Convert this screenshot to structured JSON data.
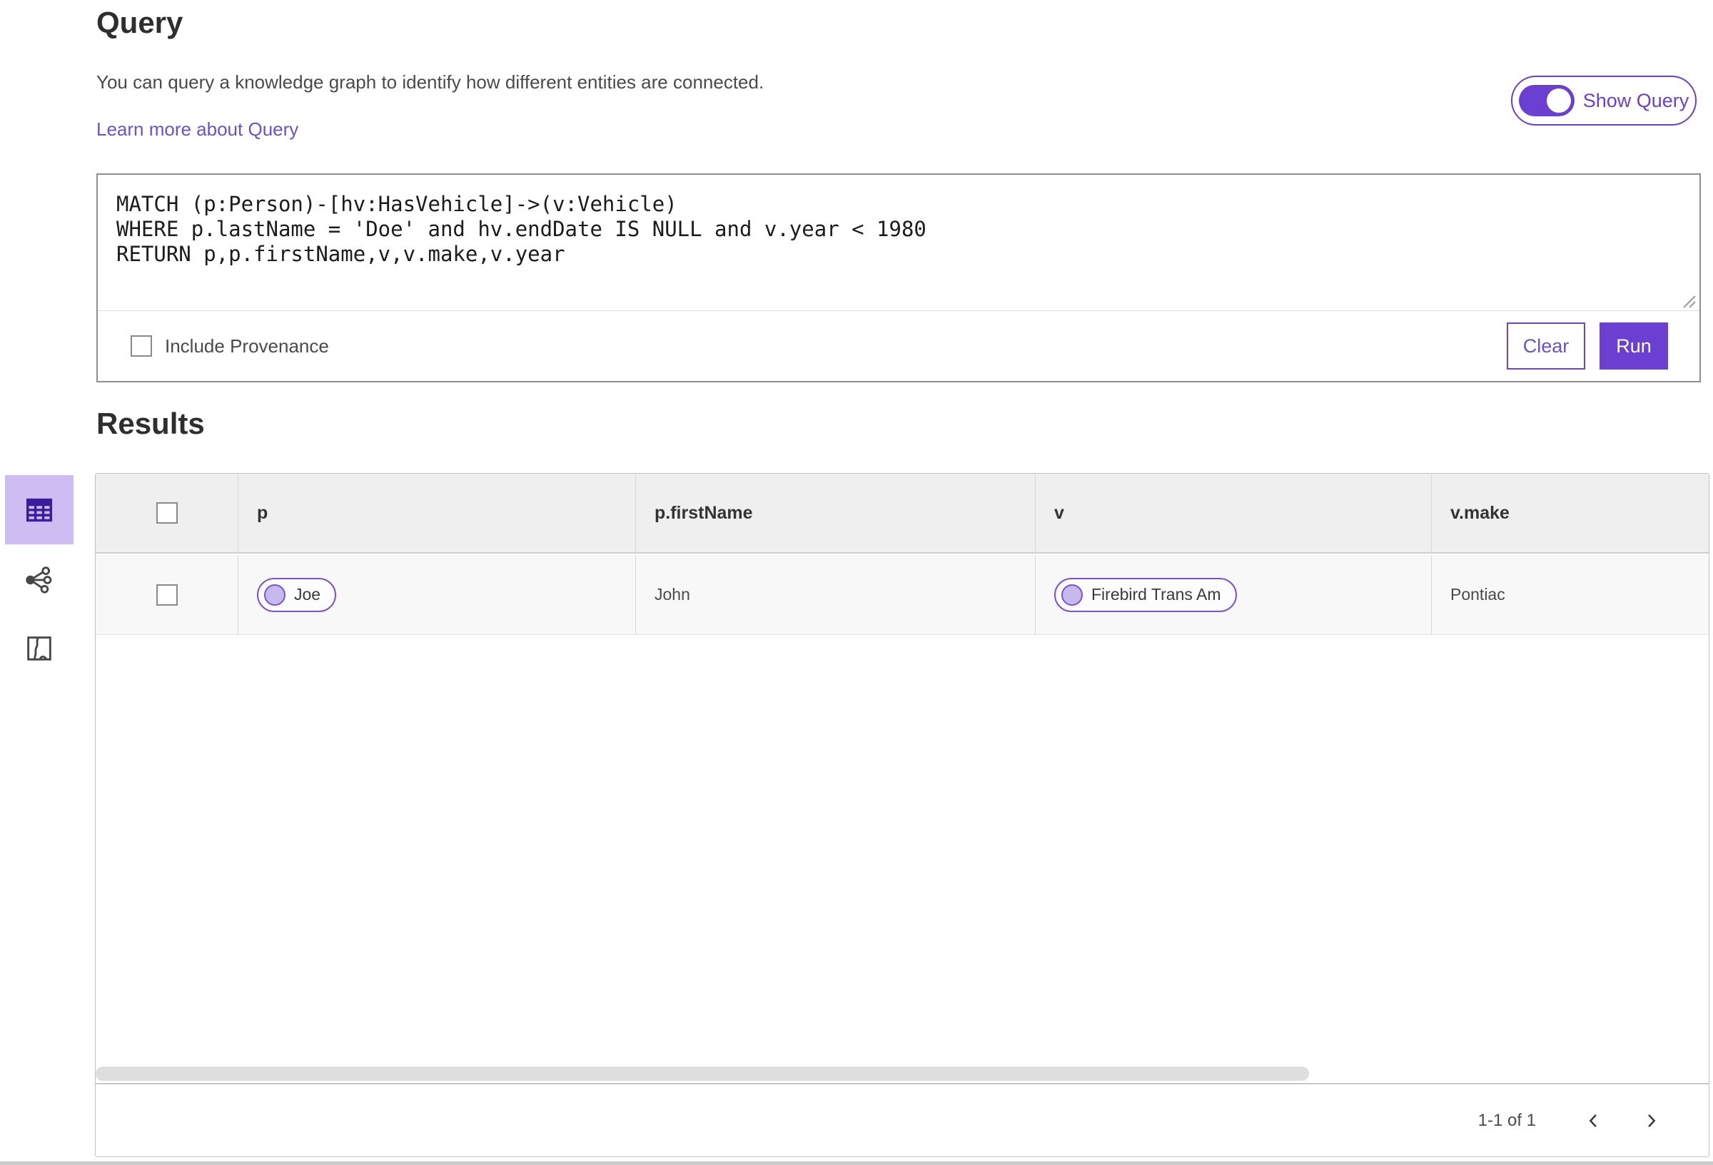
{
  "header": {
    "title": "Query",
    "description": "You can query a knowledge graph to identify how different entities are connected.",
    "learn_more_label": "Learn more about Query",
    "show_query_label": "Show Query",
    "show_query_on": true
  },
  "query_editor": {
    "code": "MATCH (p:Person)-[hv:HasVehicle]->(v:Vehicle)\nWHERE p.lastName = 'Doe' and hv.endDate IS NULL and v.year < 1980\nRETURN p,p.firstName,v,v.make,v.year",
    "include_provenance_label": "Include Provenance",
    "include_provenance_checked": false,
    "clear_label": "Clear",
    "run_label": "Run"
  },
  "results": {
    "title": "Results",
    "view_tabs": [
      {
        "name": "table-view",
        "icon": "table-icon",
        "selected": true
      },
      {
        "name": "link-chart-view",
        "icon": "link-chart-icon",
        "selected": false
      },
      {
        "name": "map-view",
        "icon": "map-icon",
        "selected": false
      }
    ],
    "table": {
      "columns": [
        "p",
        "p.firstName",
        "v",
        "v.make"
      ],
      "rows": [
        {
          "selected": false,
          "cells": {
            "p": {
              "type": "entity-pill",
              "label": "Joe"
            },
            "p_firstName": "John",
            "v": {
              "type": "entity-pill",
              "label": "Firebird Trans Am"
            },
            "v_make": "Pontiac"
          }
        }
      ]
    },
    "pagination": {
      "range_label": "1-1 of 1",
      "prev_icon": "chevron-left-icon",
      "next_icon": "chevron-right-icon"
    }
  },
  "colors": {
    "accent_purple": "#6b3fd1",
    "accent_light_purple": "#cdbdf3",
    "link_purple": "#6a52cf",
    "pill_border": "#7a52d8",
    "pill_dot_fill": "#c7b9ed",
    "table_header_bg": "#efefef",
    "table_row_bg": "#f8f8f8"
  }
}
